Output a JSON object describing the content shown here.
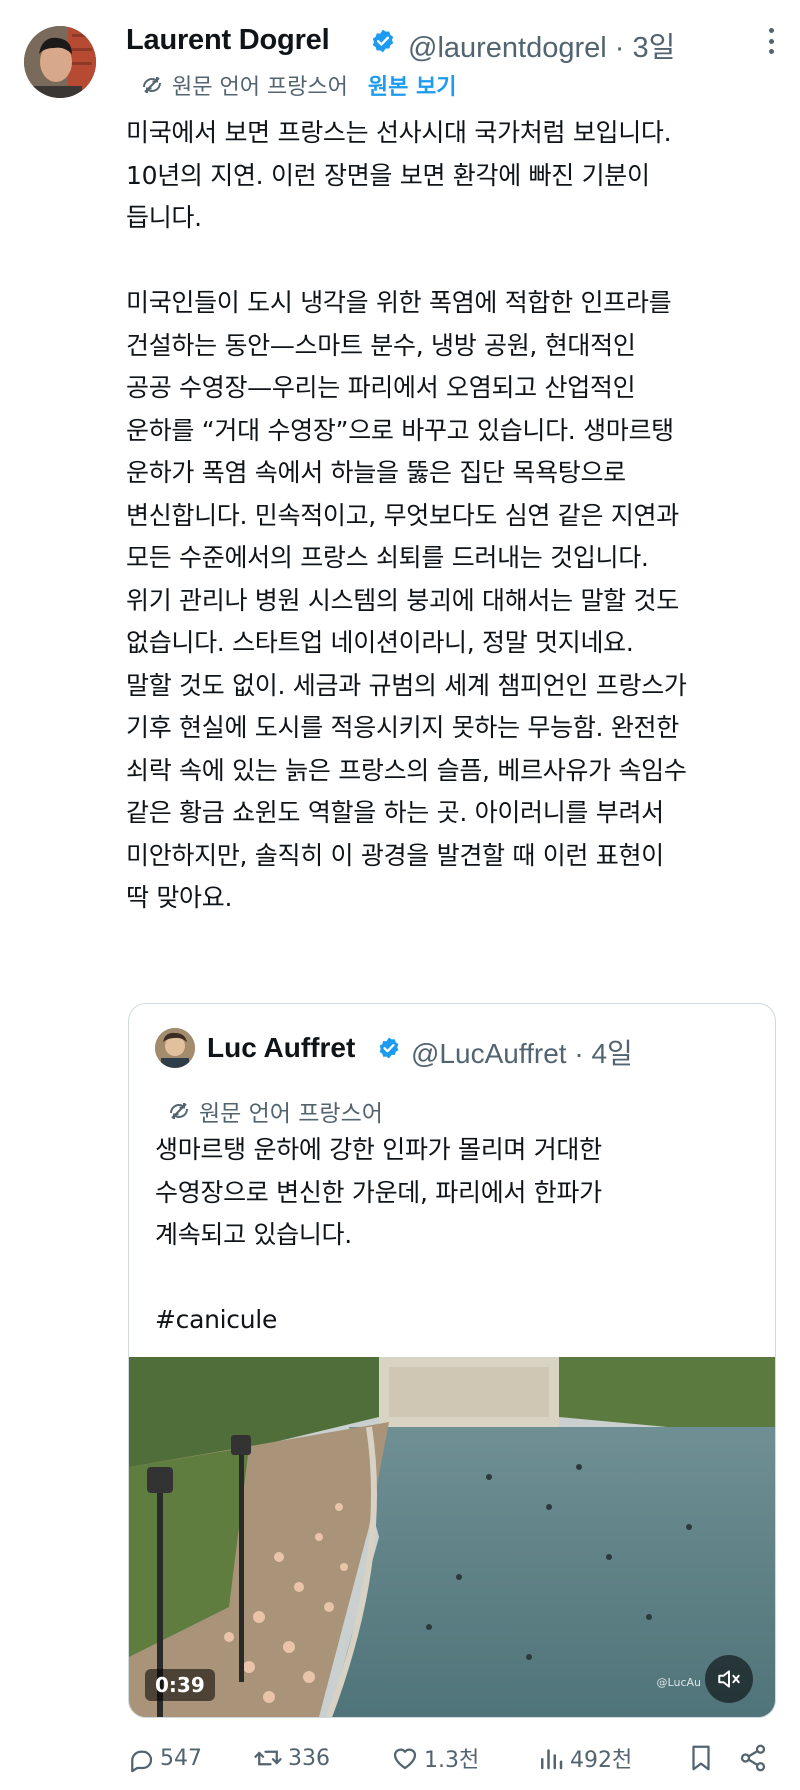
{
  "tweet": {
    "author_name": "Laurent Dogrel",
    "author_handle": "@laurentdogrel",
    "time": "3일",
    "separator": "·",
    "translated_from": "원문 언어 프랑스어",
    "view_original": "원본 보기",
    "body": "미국에서 보면 프랑스는 선사시대 국가처럼 보입니다.\n10년의 지연. 이런 장면을 보면 환각에 빠진 기분이\n듭니다.\n\n미국인들이 도시 냉각을 위한 폭염에 적합한 인프라를\n건설하는 동안—스마트 분수, 냉방 공원, 현대적인\n공공 수영장—우리는 파리에서 오염되고 산업적인\n운하를 “거대 수영장”으로 바꾸고 있습니다. 생마르탱\n운하가 폭염 속에서 하늘을 뚫은 집단 목욕탕으로\n변신합니다. 민속적이고, 무엇보다도 심연 같은 지연과\n모든 수준에서의 프랑스 쇠퇴를 드러내는 것입니다.\n위기 관리나 병원 시스템의 붕괴에 대해서는 말할 것도\n없습니다. 스타트업 네이션이라니, 정말 멋지네요.\n말할 것도 없이. 세금과 규범의 세계 챔피언인 프랑스가\n기후 현실에 도시를 적응시키지 못하는 무능함. 완전한\n쇠락 속에 있는 늙은 프랑스의 슬픔, 베르사유가 속임수\n같은 황금 쇼윈도 역할을 하는 곳. 아이러니를 부려서\n미안하지만, 솔직히 이 광경을 발견할 때 이런 표현이\n딱 맞아요."
  },
  "quoted": {
    "author_name": "Luc Auffret",
    "author_handle": "@LucAuffret",
    "time": "4일",
    "separator": "·",
    "translated_from": "원문 언어 프랑스어",
    "body": "생마르탱 운하에 강한 인파가 몰리며 거대한\n수영장으로 변신한 가운데, 파리에서 한파가\n계속되고 있습니다.\n\n#canicule",
    "video_duration": "0:39",
    "watermark": "@LucAu"
  },
  "actions": {
    "replies": "547",
    "reposts": "336",
    "likes": "1.3천",
    "views": "492천"
  },
  "colors": {
    "accent": "#1d9bf0",
    "secondary_text": "#536471",
    "border": "#cfd9de"
  },
  "icons": [
    "verified-icon",
    "more-icon",
    "translate-icon",
    "mute-icon",
    "reply-icon",
    "repost-icon",
    "like-icon",
    "views-icon",
    "bookmark-icon",
    "share-icon"
  ]
}
